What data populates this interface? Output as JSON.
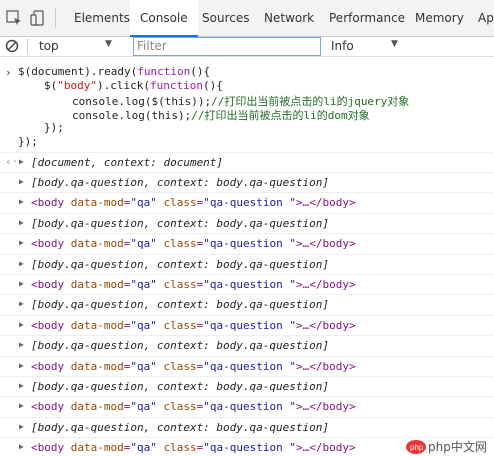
{
  "tabs": [
    {
      "label": "Elements"
    },
    {
      "label": "Console"
    },
    {
      "label": "Sources"
    },
    {
      "label": "Network"
    },
    {
      "label": "Performance"
    },
    {
      "label": "Memory"
    },
    {
      "label": "Ap"
    }
  ],
  "filterbar": {
    "context": "top",
    "filter_placeholder": "Filter",
    "level": "Info"
  },
  "code": {
    "line1": "$(document).ready(function(){",
    "line2": "$(\"body\").click(function(){",
    "line3": "console.log($(this));//打印出当前被点击的li的jquery对象",
    "line4": "console.log(this);//打印出当前被点击的li的dom对象",
    "line5": "});",
    "line6": "});"
  },
  "result": "[document, context: document]",
  "entries": {
    "jq": "[body.qa-question, context: body.qa-question]",
    "dom_tag": "<body",
    "dom_attr1": "data-mod",
    "dom_val1": "\"qa\"",
    "dom_attr2": "class",
    "dom_val2": "\"qa-question \"",
    "dom_ellipsis": ">…",
    "dom_close": "</body>"
  },
  "watermark": "php中文网",
  "colors": {
    "accent": "#1a73e8",
    "tag": "#881280",
    "attr": "#994500",
    "value": "#1a1aa6",
    "comment": "#236e25"
  }
}
